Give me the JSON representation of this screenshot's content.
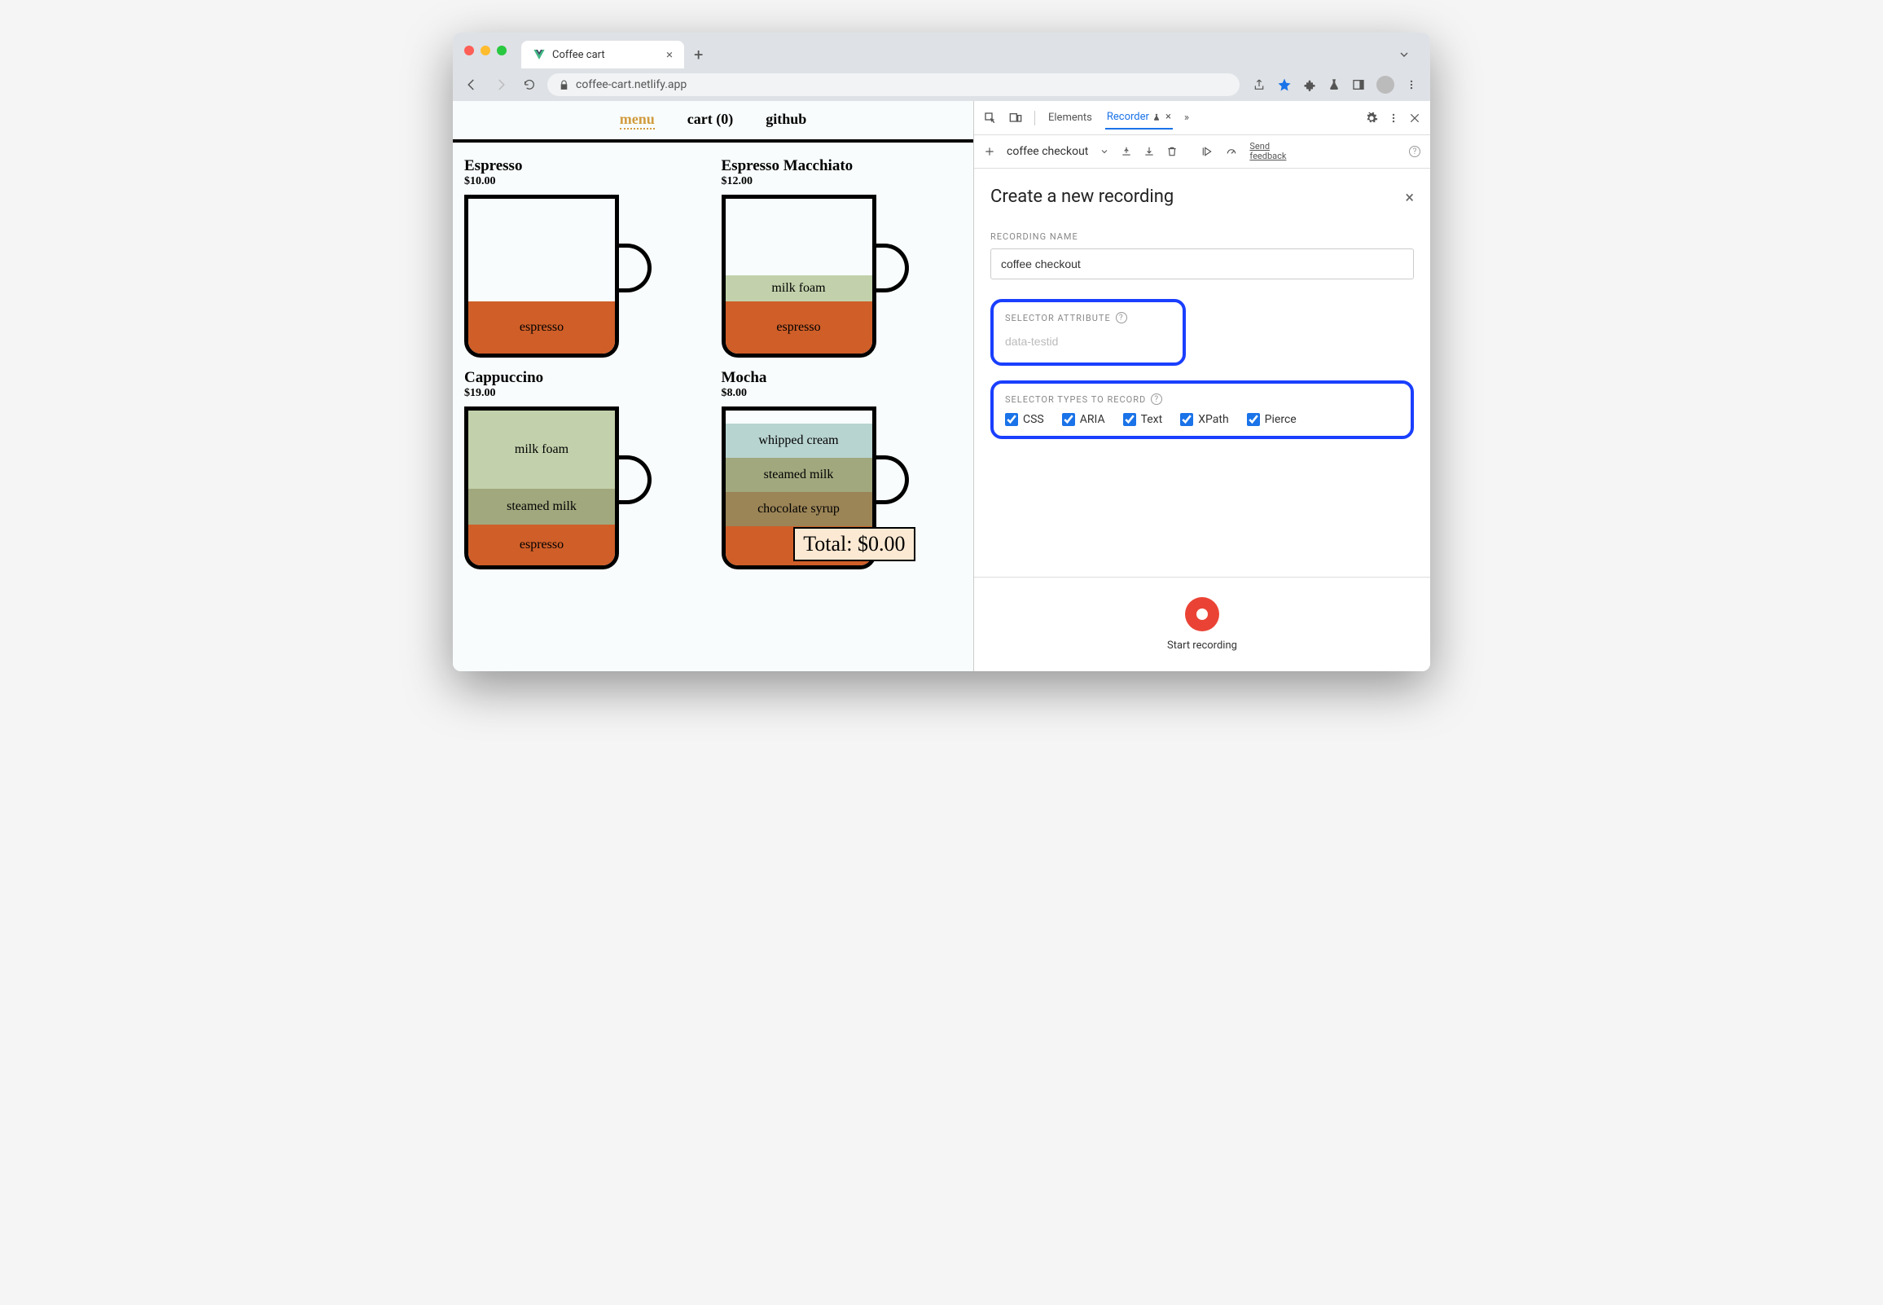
{
  "browser": {
    "tab_title": "Coffee cart",
    "url": "coffee-cart.netlify.app"
  },
  "page": {
    "nav": {
      "menu": "menu",
      "cart": "cart (0)",
      "github": "github"
    },
    "products": [
      {
        "name": "Espresso",
        "price": "$10.00",
        "layers": [
          {
            "label": "espresso",
            "cls": "l-espresso",
            "h": 64
          }
        ]
      },
      {
        "name": "Espresso Macchiato",
        "price": "$12.00",
        "layers": [
          {
            "label": "milk foam",
            "cls": "l-milkfoam",
            "h": 32
          },
          {
            "label": "espresso",
            "cls": "l-espresso",
            "h": 64
          }
        ]
      },
      {
        "name": "Cappuccino",
        "price": "$19.00",
        "layers": [
          {
            "label": "milk foam",
            "cls": "l-milkfoam",
            "h": 96
          },
          {
            "label": "steamed milk",
            "cls": "l-steamed",
            "h": 44
          },
          {
            "label": "espresso",
            "cls": "l-espresso",
            "h": 50
          }
        ]
      },
      {
        "name": "Mocha",
        "price": "$8.00",
        "layers": [
          {
            "label": "whipped cream",
            "cls": "l-whipped",
            "h": 42
          },
          {
            "label": "steamed milk",
            "cls": "l-steamed",
            "h": 42
          },
          {
            "label": "chocolate syrup",
            "cls": "l-chocsyrup",
            "h": 42
          },
          {
            "label": "",
            "cls": "l-espresso",
            "h": 48
          }
        ]
      }
    ],
    "total_label": "Total: $0.00"
  },
  "devtools": {
    "tabs": {
      "elements": "Elements",
      "recorder": "Recorder"
    },
    "toolbar": {
      "flow_name": "coffee checkout",
      "feedback": "Send feedback"
    },
    "form": {
      "title": "Create a new recording",
      "name_label": "RECORDING NAME",
      "name_value": "coffee checkout",
      "attr_label": "SELECTOR ATTRIBUTE",
      "attr_placeholder": "data-testid",
      "types_label": "SELECTOR TYPES TO RECORD",
      "types": {
        "css": "CSS",
        "aria": "ARIA",
        "text": "Text",
        "xpath": "XPath",
        "pierce": "Pierce"
      }
    },
    "footer": {
      "start": "Start recording"
    }
  }
}
